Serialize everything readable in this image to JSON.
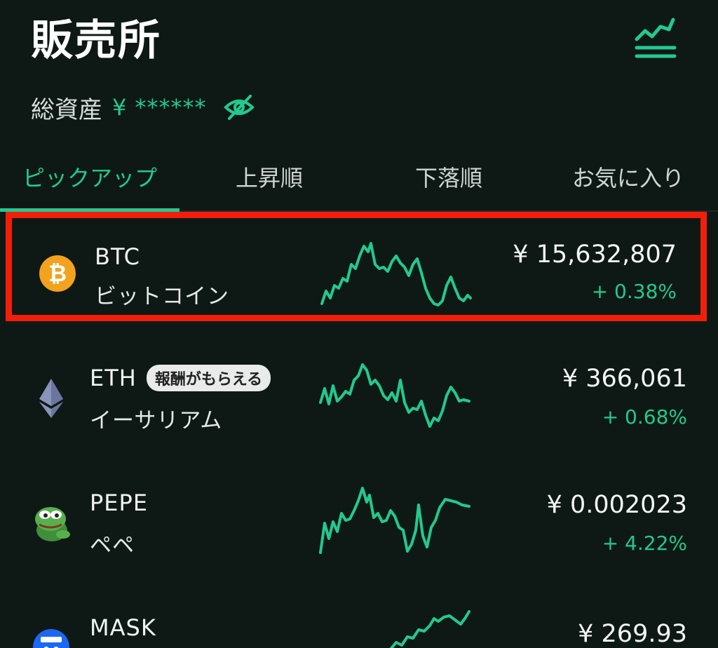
{
  "header": {
    "title": "販売所"
  },
  "assets": {
    "label": "総資産",
    "value": "¥ ******"
  },
  "tabs": [
    {
      "label": "ピックアップ",
      "active": true
    },
    {
      "label": "上昇順",
      "active": false
    },
    {
      "label": "下落順",
      "active": false
    },
    {
      "label": "お気に入り",
      "active": false
    }
  ],
  "colors": {
    "accent": "#23c98f",
    "background": "#0e1916",
    "highlight_border": "#f21e0a"
  },
  "coins": [
    {
      "symbol": "BTC",
      "name": "ビットコイン",
      "price": "¥ 15,632,807",
      "change": "+ 0.38%",
      "icon": "bitcoin-icon",
      "badge": ""
    },
    {
      "symbol": "ETH",
      "name": "イーサリアム",
      "price": "¥ 366,061",
      "change": "+ 0.68%",
      "icon": "ethereum-icon",
      "badge": "報酬がもらえる"
    },
    {
      "symbol": "PEPE",
      "name": "ペペ",
      "price": "¥ 0.002023",
      "change": "+ 4.22%",
      "icon": "pepe-frog-icon",
      "badge": ""
    },
    {
      "symbol": "MASK",
      "name": "",
      "price": "¥ 269.93",
      "change": "",
      "icon": "mask-icon",
      "badge": ""
    }
  ]
}
